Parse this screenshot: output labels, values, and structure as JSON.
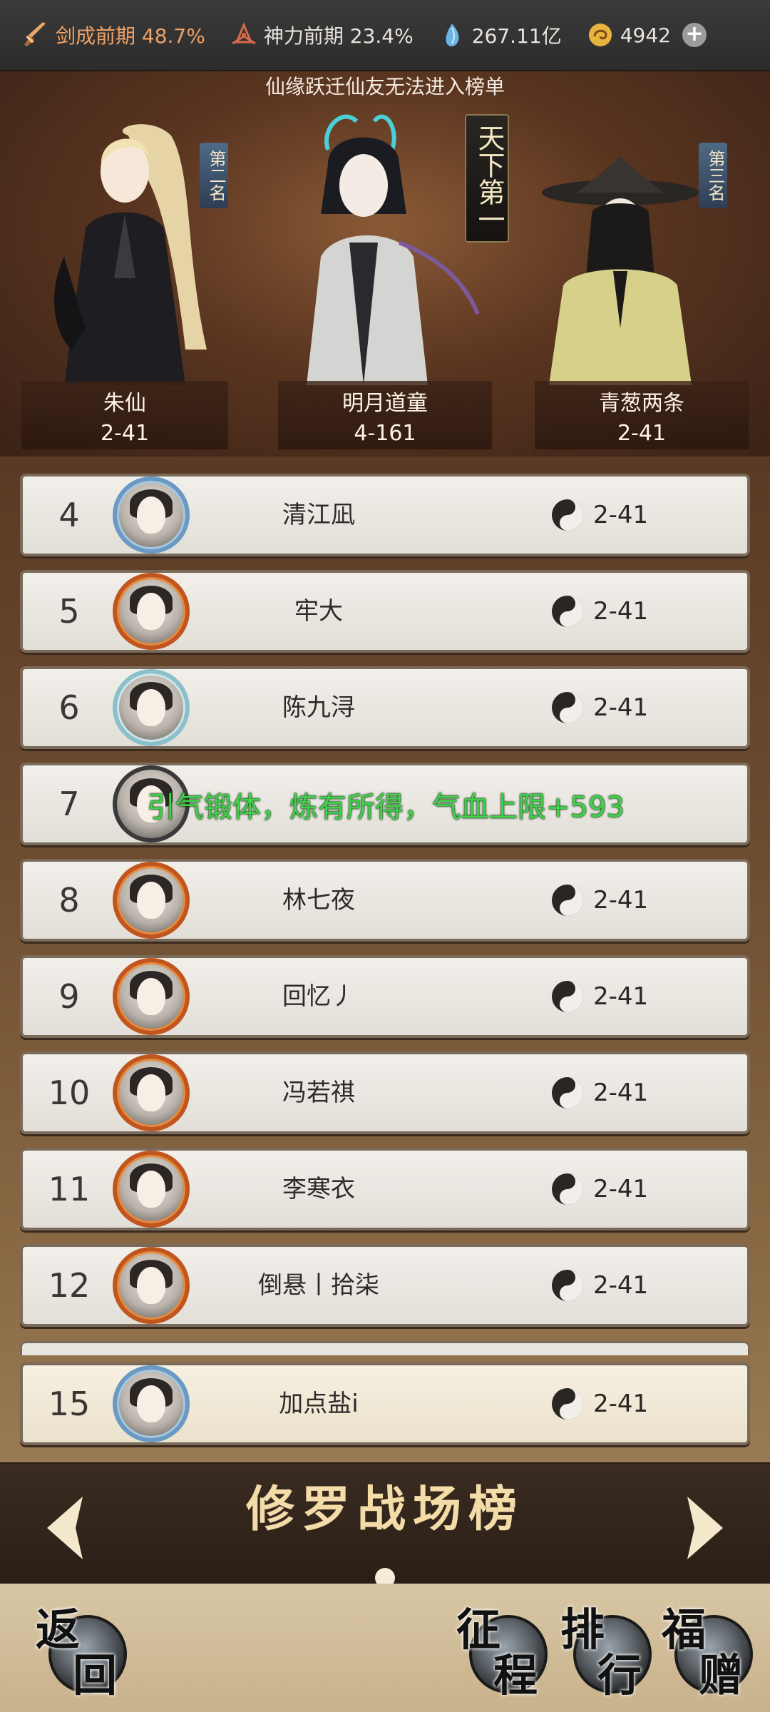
{
  "topbar": {
    "stats": [
      {
        "icon": "sword-icon",
        "text": "剑成前期 48.7%"
      },
      {
        "icon": "lotus-icon",
        "text": "神力前期 23.4%"
      },
      {
        "icon": "crystal-icon",
        "text": "267.11亿"
      },
      {
        "icon": "coin-icon",
        "text": "4942"
      }
    ],
    "plus_label": "+"
  },
  "notice": "仙缘跃迁仙友无法进入榜单",
  "podium": {
    "first": {
      "tag": "天下第一",
      "name": "明月道童",
      "score": "4-161"
    },
    "second": {
      "tag": "第二名",
      "name": "朱仙",
      "score": "2-41"
    },
    "third": {
      "tag": "第三名",
      "name": "青葱两条",
      "score": "2-41"
    }
  },
  "ranking": [
    {
      "rank": "4",
      "name": "清江凪",
      "score": "2-41",
      "frame": "blue"
    },
    {
      "rank": "5",
      "name": "牢大",
      "score": "2-41",
      "frame": "orange"
    },
    {
      "rank": "6",
      "name": "陈九浔",
      "score": "2-41",
      "frame": "teal"
    },
    {
      "rank": "7",
      "name": "",
      "score": "",
      "frame": "plain"
    },
    {
      "rank": "8",
      "name": "林七夜",
      "score": "2-41",
      "frame": "orange"
    },
    {
      "rank": "9",
      "name": "回忆丿",
      "score": "2-41",
      "frame": "orange"
    },
    {
      "rank": "10",
      "name": "冯若祺",
      "score": "2-41",
      "frame": "orange"
    },
    {
      "rank": "11",
      "name": "李寒衣",
      "score": "2-41",
      "frame": "orange"
    },
    {
      "rank": "12",
      "name": "倒悬丨拾柒",
      "score": "2-41",
      "frame": "orange"
    }
  ],
  "my_rank": {
    "rank": "15",
    "name": "加点盐i",
    "score": "2-41",
    "frame": "blue"
  },
  "toast": "引气锻体，炼有所得，气血上限+593",
  "board": {
    "title": "修罗战场榜",
    "page_count": 1,
    "current_page": 0
  },
  "nav": {
    "back": [
      "返",
      "回"
    ],
    "journey": [
      "征",
      "程"
    ],
    "ranking": [
      "排",
      "行"
    ],
    "gift": [
      "福",
      "赠"
    ]
  },
  "colors": {
    "topbar_bg": "#2c2c2c",
    "cultivation_text": "#f0a266",
    "toast_green": "#3fd24a",
    "board_title": "#f3dca8",
    "avatar_frame_orange": "#c0561e"
  }
}
